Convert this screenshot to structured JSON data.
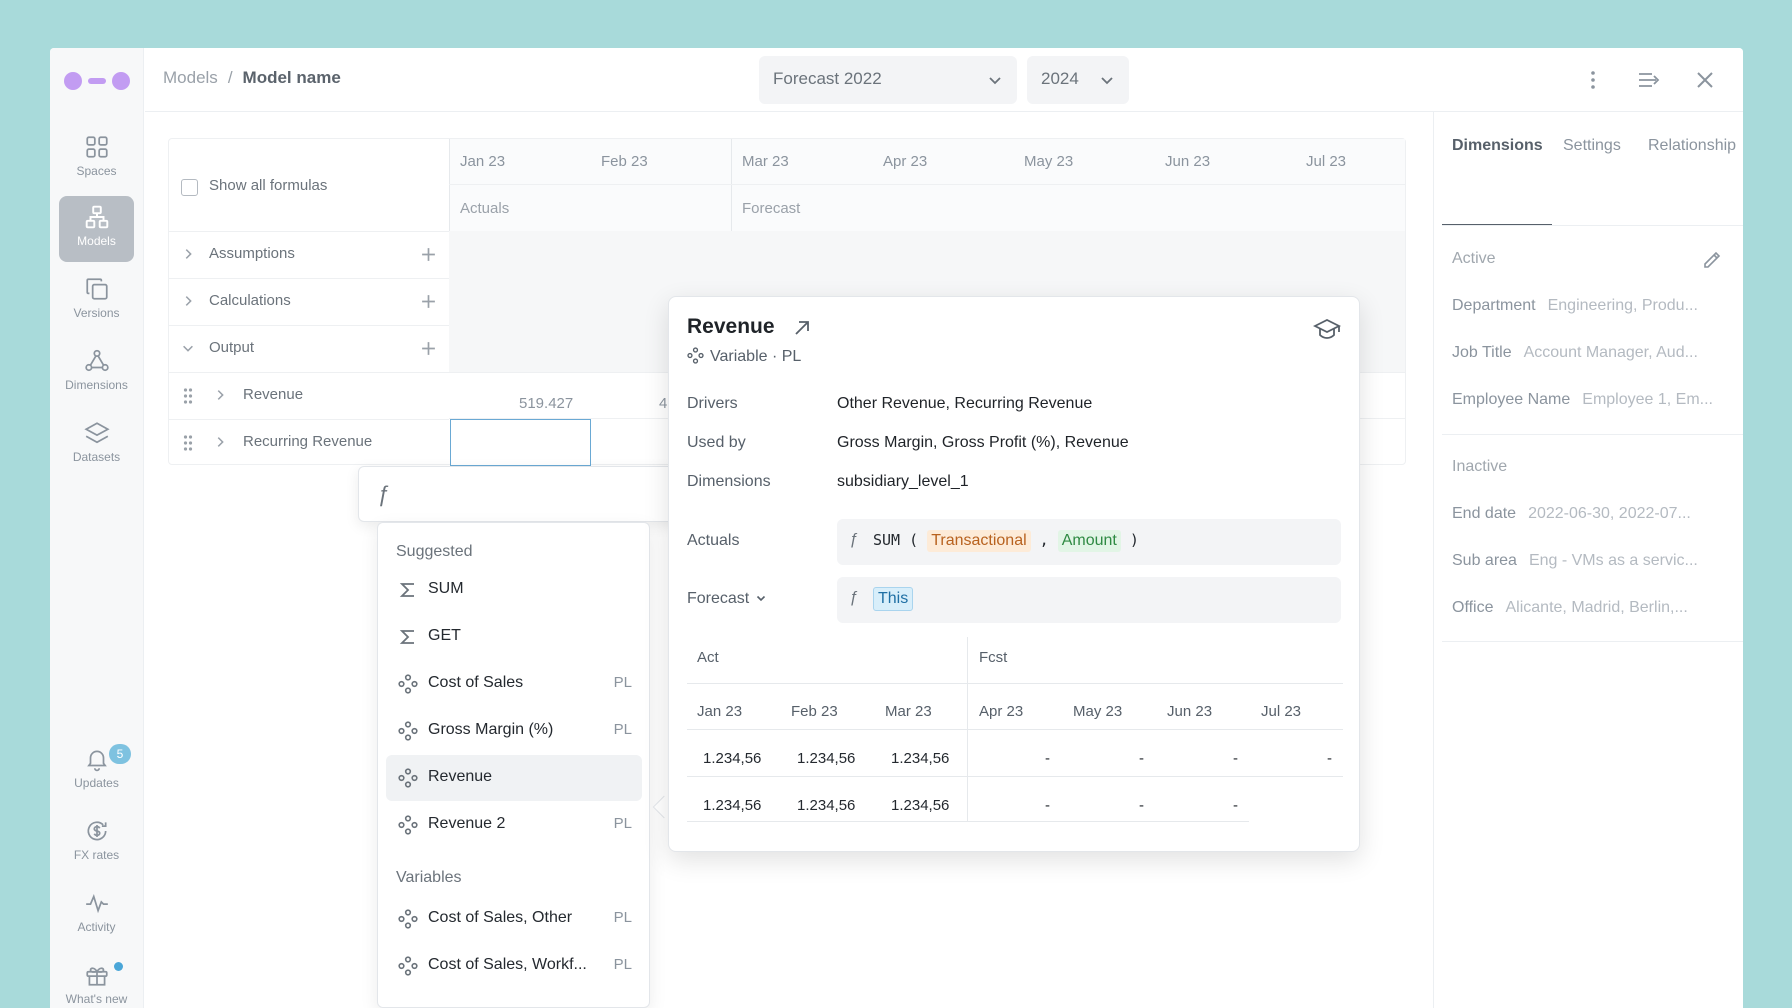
{
  "breadcrumb": {
    "parent": "Models",
    "separator": "/",
    "current": "Model name"
  },
  "selectors": {
    "scenario": "Forecast 2022",
    "year": "2024"
  },
  "rail": {
    "items": [
      {
        "label": "Spaces",
        "icon": "grid-icon"
      },
      {
        "label": "Models",
        "icon": "hierarchy-icon",
        "active": true
      },
      {
        "label": "Versions",
        "icon": "copy-icon"
      },
      {
        "label": "Dimensions",
        "icon": "network-icon"
      },
      {
        "label": "Datasets",
        "icon": "layers-icon"
      }
    ],
    "bottom": [
      {
        "label": "Updates",
        "icon": "bell-icon",
        "badge": "5"
      },
      {
        "label": "FX rates",
        "icon": "currency-icon"
      },
      {
        "label": "Activity",
        "icon": "activity-icon"
      },
      {
        "label": "What's new",
        "icon": "gift-icon"
      }
    ]
  },
  "grid": {
    "show_formulas": "Show all formulas",
    "months": [
      "Jan 23",
      "Feb 23",
      "Mar 23",
      "Apr 23",
      "May 23",
      "Jun 23",
      "Jul 23"
    ],
    "phases": {
      "actuals": "Actuals",
      "forecast": "Forecast"
    },
    "groups": [
      "Assumptions",
      "Calculations",
      "Output"
    ],
    "rows": [
      {
        "name": "Revenue",
        "value": "519.427",
        "value2": "4"
      },
      {
        "name": "Recurring Revenue"
      }
    ]
  },
  "formula_input": {
    "symbol": "ƒ"
  },
  "suggestions": {
    "suggested_label": "Suggested",
    "suggested": [
      {
        "label": "SUM",
        "icon": "sigma-icon",
        "tag": ""
      },
      {
        "label": "GET",
        "icon": "sigma-icon",
        "tag": ""
      },
      {
        "label": "Cost of Sales",
        "icon": "variable-icon",
        "tag": "PL"
      },
      {
        "label": "Gross Margin (%)",
        "icon": "variable-icon",
        "tag": "PL"
      },
      {
        "label": "Revenue",
        "icon": "variable-icon",
        "tag": "",
        "highlighted": true
      },
      {
        "label": "Revenue 2",
        "icon": "variable-icon",
        "tag": "PL"
      }
    ],
    "variables_label": "Variables",
    "variables": [
      {
        "label": "Cost of Sales, Other",
        "icon": "variable-icon",
        "tag": "PL"
      },
      {
        "label": "Cost of Sales, Workf...",
        "icon": "variable-icon",
        "tag": "PL"
      }
    ]
  },
  "popover": {
    "title": "Revenue",
    "subtitle": "Variable · PL",
    "drivers_label": "Drivers",
    "drivers": "Other Revenue, Recurring Revenue",
    "used_by_label": "Used by",
    "used_by": "Gross Margin, Gross Profit (%), Revenue",
    "dimensions_label": "Dimensions",
    "dimensions": "subsidiary_level_1",
    "actuals_label": "Actuals",
    "actuals_formula": {
      "fn": "SUM (",
      "arg1": "Transactional",
      "comma": ",",
      "arg2": "Amount",
      "close": ")"
    },
    "forecast_label": "Forecast",
    "forecast_formula": "This",
    "table": {
      "group_act": "Act",
      "group_fcst": "Fcst",
      "months": [
        "Jan 23",
        "Feb 23",
        "Mar 23",
        "Apr 23",
        "May 23",
        "Jun 23",
        "Jul 23"
      ],
      "rows": [
        [
          "1.234,56",
          "1.234,56",
          "1.234,56",
          "-",
          "-",
          "-",
          "-"
        ],
        [
          "1.234,56",
          "1.234,56",
          "1.234,56",
          "-",
          "-",
          "-",
          ""
        ]
      ]
    }
  },
  "right_panel": {
    "tabs": [
      "Dimensions",
      "Settings",
      "Relationship"
    ],
    "active_label": "Active",
    "active": [
      {
        "key": "Department",
        "value": "Engineering, Produ..."
      },
      {
        "key": "Job Title",
        "value": "Account Manager, Aud..."
      },
      {
        "key": "Employee Name",
        "value": "Employee 1, Em..."
      }
    ],
    "inactive_label": "Inactive",
    "inactive": [
      {
        "key": "End date",
        "value": "2022-06-30, 2022-07..."
      },
      {
        "key": "Sub area",
        "value": "Eng - VMs as a servic..."
      },
      {
        "key": "Office",
        "value": "Alicante, Madrid, Berlin,..."
      }
    ]
  },
  "colors": {
    "accent": "#c29cf2",
    "background": "#a8dada",
    "chip_orange": "#fdebd8",
    "chip_green": "#e2f5e6",
    "chip_blue": "#d8eefa"
  }
}
